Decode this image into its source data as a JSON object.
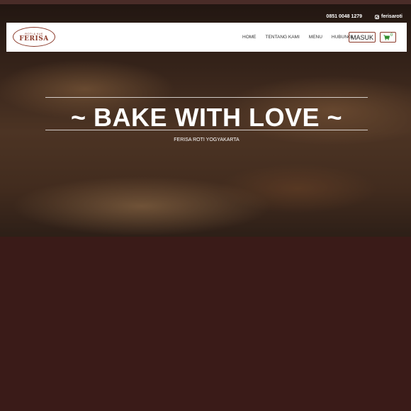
{
  "contact": {
    "phone": "0851 0048 1279",
    "instagram": "ferisaroti"
  },
  "logo": {
    "tagline": "ROTI & KUE",
    "name": "FERISA"
  },
  "nav": {
    "items": [
      {
        "label": "HOME"
      },
      {
        "label": "TENTANG KAMI"
      },
      {
        "label": "MENU"
      },
      {
        "label": "HUBUNGI"
      }
    ],
    "login_label": "MASUK",
    "cart_count": "0"
  },
  "hero": {
    "title": "~ BAKE WITH LOVE ~",
    "subtitle": "FERISA ROTI YOGYAKARTA"
  },
  "colors": {
    "brand": "#8b3a2a",
    "page_bg": "#3a1b18",
    "cart_green": "#2f8f2f"
  }
}
